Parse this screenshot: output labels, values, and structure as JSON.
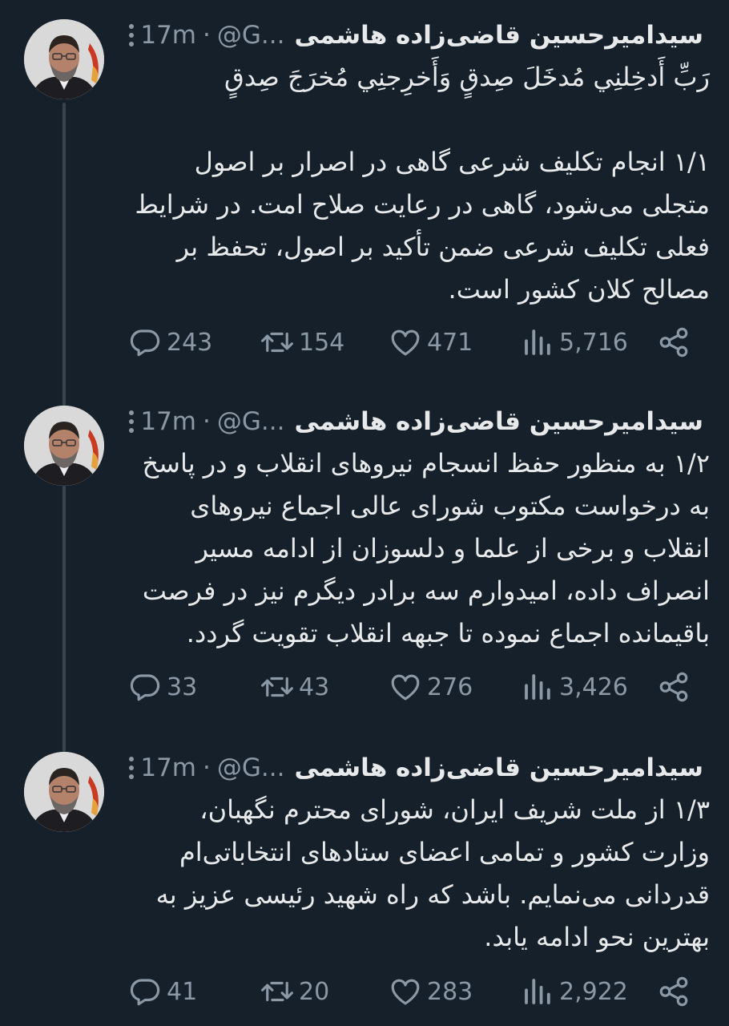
{
  "author": {
    "name": "سیدامیرحسین قاضی‌زاده هاشمی",
    "handle": "@G...",
    "time": "17m"
  },
  "tweets": [
    {
      "text": "رَبِّ أَدخِلنِي مُدخَلَ صِدقٍ وَأَخرِجنِي مُخرَجَ صِدقٍ\n\n۱/۱ انجام تکلیف شرعی گاهی در اصرار بر اصول متجلی می‌شود، گاهی در رعایت صلاح امت. در شرایط فعلی تکلیف شرعی ضمن تأکید بر اصول، تحفظ بر مصالح کلان کشور است.",
      "replies": "243",
      "retweets": "154",
      "likes": "471",
      "views": "5,716"
    },
    {
      "text": "۱/۲ به منظور حفظ انسجام نیروهای انقلاب و در پاسخ به درخواست مکتوب شورای عالی اجماع نیروهای انقلاب و برخی از علما و دلسوزان از ادامه مسیر انصراف داده، امیدوارم سه برادر دیگرم نیز در فرصت باقیمانده اجماع نموده تا جبهه انقلاب تقویت گردد.",
      "replies": "33",
      "retweets": "43",
      "likes": "276",
      "views": "3,426"
    },
    {
      "text": "۱/۳ از ملت شریف ایران، شورای محترم نگهبان، وزارت کشور و تمامی اعضای ستادهای انتخاباتی‌ام قدردانی می‌نمایم. باشد که راه شهید رئیسی عزیز به بهترین نحو ادامه یابد.",
      "replies": "41",
      "retweets": "20",
      "likes": "283",
      "views": "2,922"
    }
  ],
  "colors": {
    "background": "#15202b",
    "text": "#e7e9ea",
    "muted": "#8b98a5",
    "thread_line": "#38444d"
  }
}
